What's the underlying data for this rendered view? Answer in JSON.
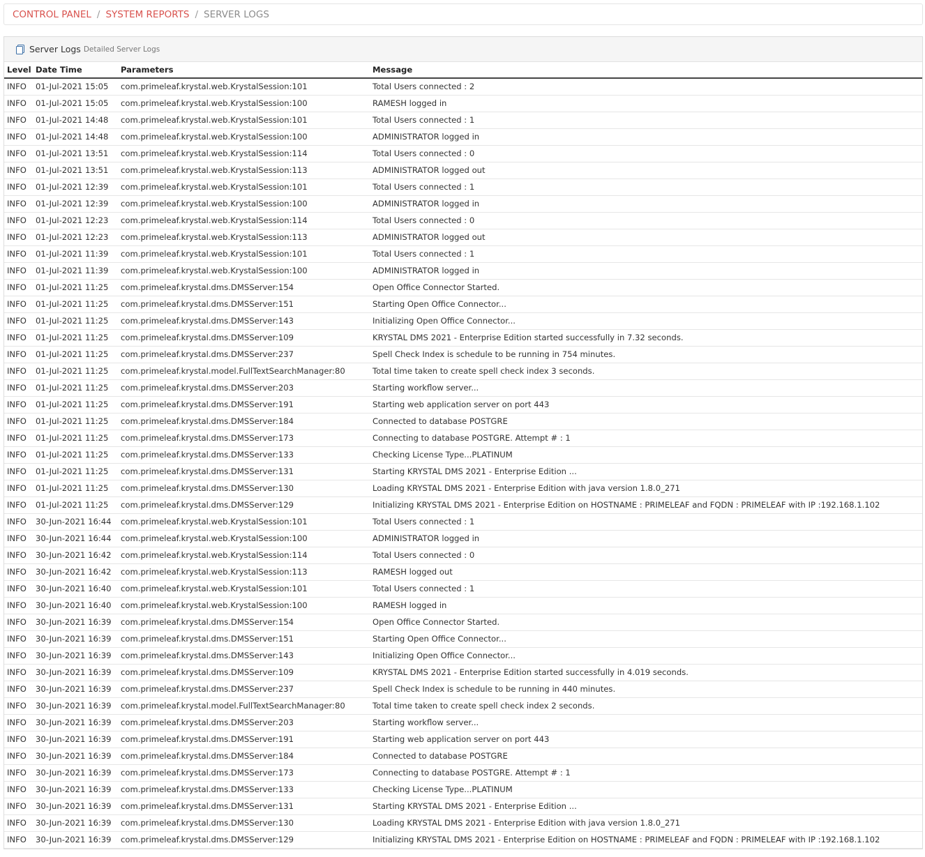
{
  "breadcrumb": {
    "control_panel": "CONTROL PANEL",
    "system_reports": "SYSTEM REPORTS",
    "server_logs": "SERVER LOGS",
    "separator": "/"
  },
  "panel": {
    "icon": "document-icon",
    "title": "Server Logs",
    "subtitle": "Detailed Server Logs"
  },
  "table": {
    "headers": [
      "Level",
      "Date Time",
      "Parameters",
      "Message"
    ],
    "rows": [
      [
        "INFO",
        "01-Jul-2021 15:05",
        "com.primeleaf.krystal.web.KrystalSession:101",
        "Total Users connected : 2"
      ],
      [
        "INFO",
        "01-Jul-2021 15:05",
        "com.primeleaf.krystal.web.KrystalSession:100",
        "RAMESH logged in"
      ],
      [
        "INFO",
        "01-Jul-2021 14:48",
        "com.primeleaf.krystal.web.KrystalSession:101",
        "Total Users connected : 1"
      ],
      [
        "INFO",
        "01-Jul-2021 14:48",
        "com.primeleaf.krystal.web.KrystalSession:100",
        "ADMINISTRATOR logged in"
      ],
      [
        "INFO",
        "01-Jul-2021 13:51",
        "com.primeleaf.krystal.web.KrystalSession:114",
        "Total Users connected : 0"
      ],
      [
        "INFO",
        "01-Jul-2021 13:51",
        "com.primeleaf.krystal.web.KrystalSession:113",
        "ADMINISTRATOR logged out"
      ],
      [
        "INFO",
        "01-Jul-2021 12:39",
        "com.primeleaf.krystal.web.KrystalSession:101",
        "Total Users connected : 1"
      ],
      [
        "INFO",
        "01-Jul-2021 12:39",
        "com.primeleaf.krystal.web.KrystalSession:100",
        "ADMINISTRATOR logged in"
      ],
      [
        "INFO",
        "01-Jul-2021 12:23",
        "com.primeleaf.krystal.web.KrystalSession:114",
        "Total Users connected : 0"
      ],
      [
        "INFO",
        "01-Jul-2021 12:23",
        "com.primeleaf.krystal.web.KrystalSession:113",
        "ADMINISTRATOR logged out"
      ],
      [
        "INFO",
        "01-Jul-2021 11:39",
        "com.primeleaf.krystal.web.KrystalSession:101",
        "Total Users connected : 1"
      ],
      [
        "INFO",
        "01-Jul-2021 11:39",
        "com.primeleaf.krystal.web.KrystalSession:100",
        "ADMINISTRATOR logged in"
      ],
      [
        "INFO",
        "01-Jul-2021 11:25",
        "com.primeleaf.krystal.dms.DMSServer:154",
        "Open Office Connector Started."
      ],
      [
        "INFO",
        "01-Jul-2021 11:25",
        "com.primeleaf.krystal.dms.DMSServer:151",
        "Starting Open Office Connector..."
      ],
      [
        "INFO",
        "01-Jul-2021 11:25",
        "com.primeleaf.krystal.dms.DMSServer:143",
        "Initializing Open Office Connector..."
      ],
      [
        "INFO",
        "01-Jul-2021 11:25",
        "com.primeleaf.krystal.dms.DMSServer:109",
        "KRYSTAL DMS 2021 - Enterprise Edition started successfully in 7.32 seconds."
      ],
      [
        "INFO",
        "01-Jul-2021 11:25",
        "com.primeleaf.krystal.dms.DMSServer:237",
        "Spell Check Index is schedule to be running in 754 minutes."
      ],
      [
        "INFO",
        "01-Jul-2021 11:25",
        "com.primeleaf.krystal.model.FullTextSearchManager:80",
        "Total time taken to create spell check index 3 seconds."
      ],
      [
        "INFO",
        "01-Jul-2021 11:25",
        "com.primeleaf.krystal.dms.DMSServer:203",
        "Starting workflow server..."
      ],
      [
        "INFO",
        "01-Jul-2021 11:25",
        "com.primeleaf.krystal.dms.DMSServer:191",
        "Starting web application server on port 443"
      ],
      [
        "INFO",
        "01-Jul-2021 11:25",
        "com.primeleaf.krystal.dms.DMSServer:184",
        "Connected to database POSTGRE"
      ],
      [
        "INFO",
        "01-Jul-2021 11:25",
        "com.primeleaf.krystal.dms.DMSServer:173",
        "Connecting to database POSTGRE. Attempt # : 1"
      ],
      [
        "INFO",
        "01-Jul-2021 11:25",
        "com.primeleaf.krystal.dms.DMSServer:133",
        "Checking License Type...PLATINUM"
      ],
      [
        "INFO",
        "01-Jul-2021 11:25",
        "com.primeleaf.krystal.dms.DMSServer:131",
        "Starting KRYSTAL DMS 2021 - Enterprise Edition ..."
      ],
      [
        "INFO",
        "01-Jul-2021 11:25",
        "com.primeleaf.krystal.dms.DMSServer:130",
        "Loading KRYSTAL DMS 2021 - Enterprise Edition with java version 1.8.0_271"
      ],
      [
        "INFO",
        "01-Jul-2021 11:25",
        "com.primeleaf.krystal.dms.DMSServer:129",
        "Initializing KRYSTAL DMS 2021 - Enterprise Edition on HOSTNAME : PRIMELEAF and FQDN : PRIMELEAF with IP :192.168.1.102"
      ],
      [
        "INFO",
        "30-Jun-2021 16:44",
        "com.primeleaf.krystal.web.KrystalSession:101",
        "Total Users connected : 1"
      ],
      [
        "INFO",
        "30-Jun-2021 16:44",
        "com.primeleaf.krystal.web.KrystalSession:100",
        "ADMINISTRATOR logged in"
      ],
      [
        "INFO",
        "30-Jun-2021 16:42",
        "com.primeleaf.krystal.web.KrystalSession:114",
        "Total Users connected : 0"
      ],
      [
        "INFO",
        "30-Jun-2021 16:42",
        "com.primeleaf.krystal.web.KrystalSession:113",
        "RAMESH logged out"
      ],
      [
        "INFO",
        "30-Jun-2021 16:40",
        "com.primeleaf.krystal.web.KrystalSession:101",
        "Total Users connected : 1"
      ],
      [
        "INFO",
        "30-Jun-2021 16:40",
        "com.primeleaf.krystal.web.KrystalSession:100",
        "RAMESH logged in"
      ],
      [
        "INFO",
        "30-Jun-2021 16:39",
        "com.primeleaf.krystal.dms.DMSServer:154",
        "Open Office Connector Started."
      ],
      [
        "INFO",
        "30-Jun-2021 16:39",
        "com.primeleaf.krystal.dms.DMSServer:151",
        "Starting Open Office Connector..."
      ],
      [
        "INFO",
        "30-Jun-2021 16:39",
        "com.primeleaf.krystal.dms.DMSServer:143",
        "Initializing Open Office Connector..."
      ],
      [
        "INFO",
        "30-Jun-2021 16:39",
        "com.primeleaf.krystal.dms.DMSServer:109",
        "KRYSTAL DMS 2021 - Enterprise Edition started successfully in 4.019 seconds."
      ],
      [
        "INFO",
        "30-Jun-2021 16:39",
        "com.primeleaf.krystal.dms.DMSServer:237",
        "Spell Check Index is schedule to be running in 440 minutes."
      ],
      [
        "INFO",
        "30-Jun-2021 16:39",
        "com.primeleaf.krystal.model.FullTextSearchManager:80",
        "Total time taken to create spell check index 2 seconds."
      ],
      [
        "INFO",
        "30-Jun-2021 16:39",
        "com.primeleaf.krystal.dms.DMSServer:203",
        "Starting workflow server..."
      ],
      [
        "INFO",
        "30-Jun-2021 16:39",
        "com.primeleaf.krystal.dms.DMSServer:191",
        "Starting web application server on port 443"
      ],
      [
        "INFO",
        "30-Jun-2021 16:39",
        "com.primeleaf.krystal.dms.DMSServer:184",
        "Connected to database POSTGRE"
      ],
      [
        "INFO",
        "30-Jun-2021 16:39",
        "com.primeleaf.krystal.dms.DMSServer:173",
        "Connecting to database POSTGRE. Attempt # : 1"
      ],
      [
        "INFO",
        "30-Jun-2021 16:39",
        "com.primeleaf.krystal.dms.DMSServer:133",
        "Checking License Type...PLATINUM"
      ],
      [
        "INFO",
        "30-Jun-2021 16:39",
        "com.primeleaf.krystal.dms.DMSServer:131",
        "Starting KRYSTAL DMS 2021 - Enterprise Edition ..."
      ],
      [
        "INFO",
        "30-Jun-2021 16:39",
        "com.primeleaf.krystal.dms.DMSServer:130",
        "Loading KRYSTAL DMS 2021 - Enterprise Edition with java version 1.8.0_271"
      ],
      [
        "INFO",
        "30-Jun-2021 16:39",
        "com.primeleaf.krystal.dms.DMSServer:129",
        "Initializing KRYSTAL DMS 2021 - Enterprise Edition on HOSTNAME : PRIMELEAF and FQDN : PRIMELEAF with IP :192.168.1.102"
      ]
    ]
  },
  "colors": {
    "link": "#d9534f",
    "muted": "#8c8c8c",
    "icon": "#3a6ea5"
  }
}
